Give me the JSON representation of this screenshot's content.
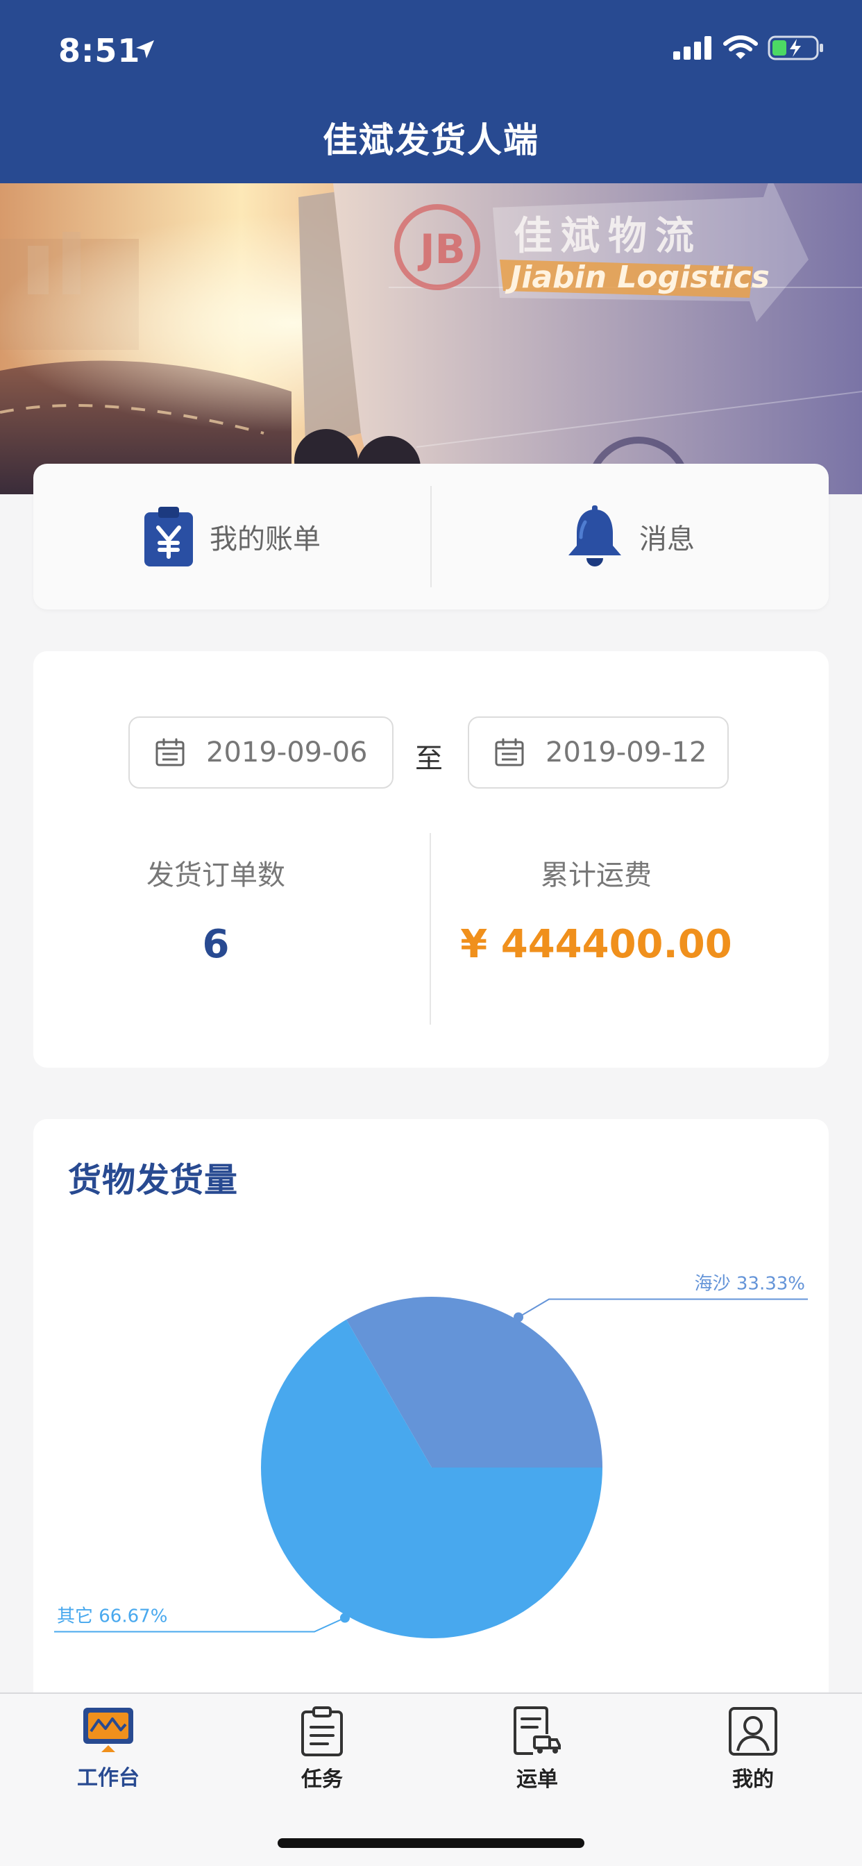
{
  "status_bar": {
    "time": "8:51"
  },
  "header": {
    "title": "佳斌发货人端"
  },
  "banner": {
    "brand_cn": "佳斌物流",
    "brand_en": "Jiabin Logistics"
  },
  "quick_actions": [
    {
      "label": "我的账单",
      "icon": "yuan-clipboard-icon"
    },
    {
      "label": "消息",
      "icon": "bell-icon"
    }
  ],
  "date_range": {
    "start": "2019-09-06",
    "separator": "至",
    "end": "2019-09-12"
  },
  "stats": {
    "orders_label": "发货订单数",
    "orders_value": "6",
    "freight_label": "累计运费",
    "freight_value": "¥ 444400.00"
  },
  "chart": {
    "title": "货物发货量"
  },
  "chart_data": {
    "type": "pie",
    "title": "货物发货量",
    "slices": [
      {
        "name": "海沙",
        "value": 33.33,
        "label": "海沙 33.33%",
        "color": "#6494d8"
      },
      {
        "name": "其它",
        "value": 66.67,
        "label": "其它 66.67%",
        "color": "#48a8ee"
      }
    ]
  },
  "tabs": [
    {
      "label": "工作台",
      "icon": "monitor-icon",
      "active": true
    },
    {
      "label": "任务",
      "icon": "clipboard-icon",
      "active": false
    },
    {
      "label": "运单",
      "icon": "waybill-truck-icon",
      "active": false
    },
    {
      "label": "我的",
      "icon": "user-icon",
      "active": false
    }
  ]
}
